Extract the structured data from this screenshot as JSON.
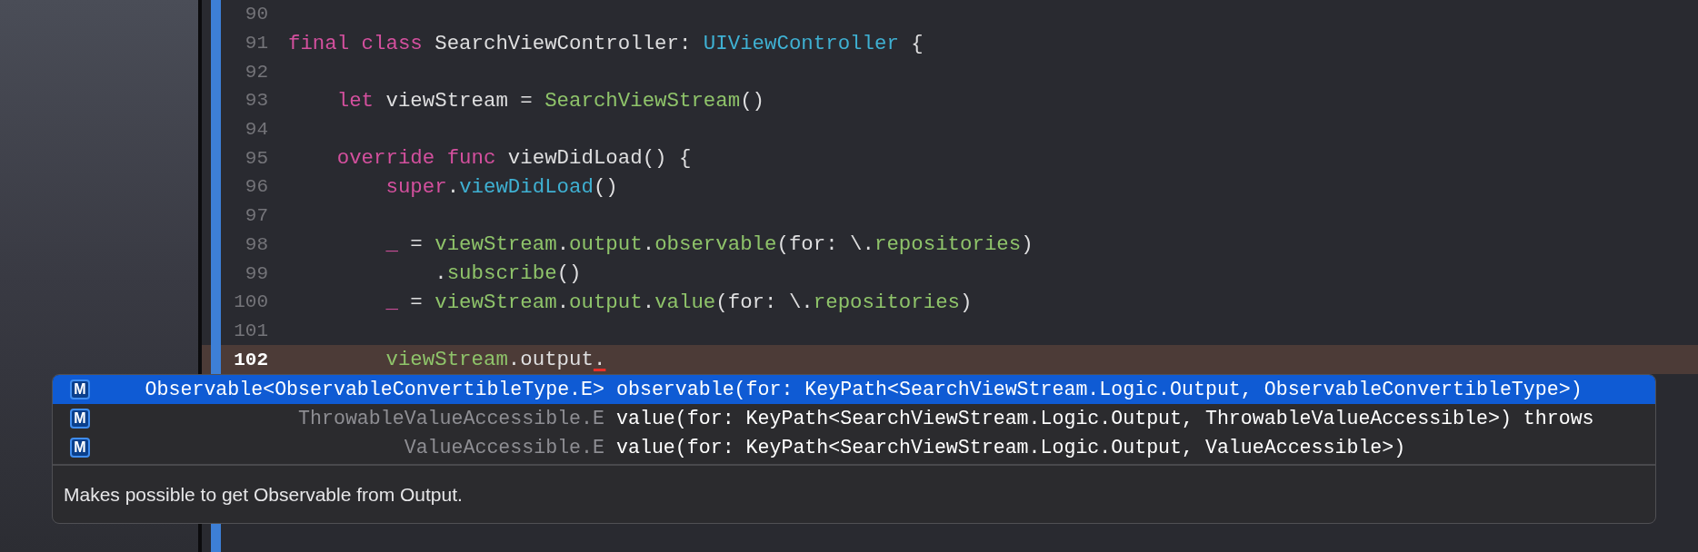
{
  "editor": {
    "lines": [
      {
        "number": "90",
        "current": false
      },
      {
        "number": "91",
        "current": false,
        "tokens": [
          {
            "text": "final class ",
            "kind": "keyword"
          },
          {
            "text": "SearchViewController",
            "kind": "plain"
          },
          {
            "text": ": ",
            "kind": "plain"
          },
          {
            "text": "UIViewController",
            "kind": "system"
          },
          {
            "text": " {",
            "kind": "plain"
          }
        ]
      },
      {
        "number": "92",
        "current": false
      },
      {
        "number": "93",
        "current": false,
        "tokens": [
          {
            "text": "    let",
            "kind": "keyword"
          },
          {
            "text": " viewStream = ",
            "kind": "plain"
          },
          {
            "text": "SearchViewStream",
            "kind": "project"
          },
          {
            "text": "()",
            "kind": "plain"
          }
        ]
      },
      {
        "number": "94",
        "current": false
      },
      {
        "number": "95",
        "current": false,
        "tokens": [
          {
            "text": "    override func",
            "kind": "keyword"
          },
          {
            "text": " viewDidLoad() {",
            "kind": "plain"
          }
        ]
      },
      {
        "number": "96",
        "current": false,
        "tokens": [
          {
            "text": "        super",
            "kind": "keyword"
          },
          {
            "text": ".",
            "kind": "plain"
          },
          {
            "text": "viewDidLoad",
            "kind": "system"
          },
          {
            "text": "()",
            "kind": "plain"
          }
        ]
      },
      {
        "number": "97",
        "current": false
      },
      {
        "number": "98",
        "current": false,
        "tokens": [
          {
            "text": "        _",
            "kind": "keyword"
          },
          {
            "text": " = ",
            "kind": "plain"
          },
          {
            "text": "viewStream",
            "kind": "project"
          },
          {
            "text": ".",
            "kind": "plain"
          },
          {
            "text": "output",
            "kind": "project"
          },
          {
            "text": ".",
            "kind": "plain"
          },
          {
            "text": "observable",
            "kind": "project"
          },
          {
            "text": "(for: \\.",
            "kind": "plain"
          },
          {
            "text": "repositories",
            "kind": "project"
          },
          {
            "text": ")",
            "kind": "plain"
          }
        ]
      },
      {
        "number": "99",
        "current": false,
        "tokens": [
          {
            "text": "            .",
            "kind": "plain"
          },
          {
            "text": "subscribe",
            "kind": "project"
          },
          {
            "text": "()",
            "kind": "plain"
          }
        ]
      },
      {
        "number": "100",
        "current": false,
        "tokens": [
          {
            "text": "        _",
            "kind": "keyword"
          },
          {
            "text": " = ",
            "kind": "plain"
          },
          {
            "text": "viewStream",
            "kind": "project"
          },
          {
            "text": ".",
            "kind": "plain"
          },
          {
            "text": "output",
            "kind": "project"
          },
          {
            "text": ".",
            "kind": "plain"
          },
          {
            "text": "value",
            "kind": "project"
          },
          {
            "text": "(for: \\.",
            "kind": "plain"
          },
          {
            "text": "repositories",
            "kind": "project"
          },
          {
            "text": ")",
            "kind": "plain"
          }
        ]
      },
      {
        "number": "101",
        "current": false
      },
      {
        "number": "102",
        "current": true,
        "tokens": [
          {
            "text": "        viewStream",
            "kind": "project"
          },
          {
            "text": ".output",
            "kind": "plain"
          },
          {
            "text": ".",
            "kind": "error"
          }
        ]
      }
    ]
  },
  "completion": {
    "items": [
      {
        "icon": "M",
        "type": "Observable<ObservableConvertibleType.E>",
        "signature": "observable(for: KeyPath<SearchViewStream.Logic.Output, ObservableConvertibleType>)",
        "selected": true
      },
      {
        "icon": "M",
        "type": "ThrowableValueAccessible.E",
        "signature": "value(for: KeyPath<SearchViewStream.Logic.Output, ThrowableValueAccessible>) throws",
        "selected": false
      },
      {
        "icon": "M",
        "type": "ValueAccessible.E",
        "signature": "value(for: KeyPath<SearchViewStream.Logic.Output, ValueAccessible>)",
        "selected": false
      }
    ],
    "description": "Makes possible to get Observable from Output."
  }
}
